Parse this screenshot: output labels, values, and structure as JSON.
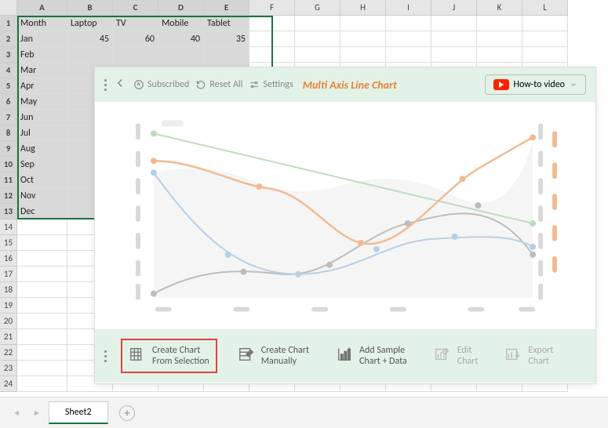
{
  "columns": [
    "A",
    "B",
    "C",
    "D",
    "E",
    "F",
    "G",
    "H",
    "I",
    "J",
    "K",
    "L"
  ],
  "rows_visible": 24,
  "selected_cols": [
    "A",
    "B",
    "C",
    "D",
    "E"
  ],
  "selected_rows": [
    1,
    2,
    3,
    4,
    5,
    6,
    7,
    8,
    9,
    10,
    11,
    12,
    13
  ],
  "headers": {
    "A": "Month",
    "B": "Laptop",
    "C": "TV",
    "D": "Mobile",
    "E": "Tablet"
  },
  "data": {
    "1": {
      "A": "Jan",
      "B": "45",
      "C": "60",
      "D": "40",
      "E": "35"
    },
    "2": {
      "A": "Feb"
    },
    "3": {
      "A": "Mar"
    },
    "4": {
      "A": "Apr"
    },
    "5": {
      "A": "May"
    },
    "6": {
      "A": "Jun"
    },
    "7": {
      "A": "Jul"
    },
    "8": {
      "A": "Aug"
    },
    "9": {
      "A": "Sep"
    },
    "10": {
      "A": "Oct"
    },
    "11": {
      "A": "Nov"
    },
    "12": {
      "A": "Dec"
    }
  },
  "panel": {
    "subscribed": "Subscribed",
    "reset": "Reset All",
    "settings": "Settings",
    "title": "Multi Axis Line Chart",
    "howto": "How-to video"
  },
  "actions": {
    "create_sel_l1": "Create Chart",
    "create_sel_l2": "From Selection",
    "create_man_l1": "Create Chart",
    "create_man_l2": "Manually",
    "sample_l1": "Add Sample",
    "sample_l2": "Chart + Data",
    "edit_l1": "Edit",
    "edit_l2": "Chart",
    "export_l1": "Export",
    "export_l2": "Chart"
  },
  "tab": "Sheet2"
}
